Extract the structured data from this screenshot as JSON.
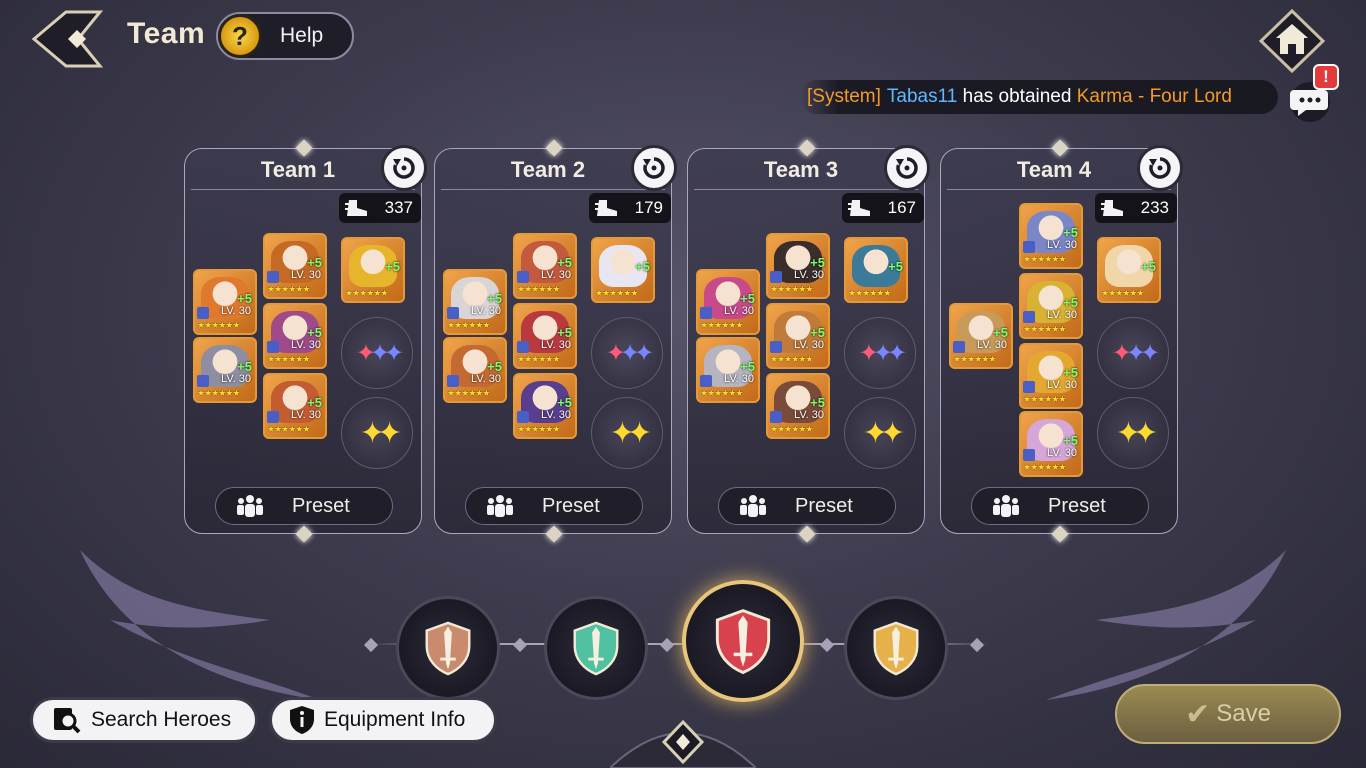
{
  "header": {
    "title": "Team",
    "help_label": "Help"
  },
  "system_message": {
    "prefix": "[System]",
    "player": "Tabas11",
    "middle": " has obtained ",
    "item": "Karma - Four Lord",
    "colors": {
      "prefix": "#f39a2c",
      "player": "#5fb7ff",
      "item": "#f39a2c",
      "text": "#ffffff"
    }
  },
  "chat": {
    "alert": "!"
  },
  "teams": [
    {
      "name": "Team 1",
      "power": "337",
      "preset_label": "Preset",
      "heroes": [
        {
          "lv": "LV. 30",
          "plus": "+5",
          "color": "#e0782e"
        },
        {
          "lv": "LV. 30",
          "plus": "+5",
          "color": "#c46a24"
        },
        {
          "lv": "LV. 30",
          "plus": "+5",
          "color": "#a04a8a"
        },
        {
          "lv": "LV. 30",
          "plus": "+5",
          "color": "#8d8ea2"
        },
        {
          "lv": "LV. 30",
          "plus": "+5",
          "color": "#c45c32"
        },
        {
          "lv": "",
          "plus": "+5",
          "color": "#e6b52c"
        }
      ]
    },
    {
      "name": "Team 2",
      "power": "179",
      "preset_label": "Preset",
      "heroes": [
        {
          "lv": "LV. 30",
          "plus": "+5",
          "color": "#d9d4d6"
        },
        {
          "lv": "LV. 30",
          "plus": "+5",
          "color": "#c35a3e"
        },
        {
          "lv": "LV. 30",
          "plus": "+5",
          "color": "#b83a3e"
        },
        {
          "lv": "LV. 30",
          "plus": "+5",
          "color": "#c36a32"
        },
        {
          "lv": "LV. 30",
          "plus": "+5",
          "color": "#5a3e8e"
        },
        {
          "lv": "",
          "plus": "+5",
          "color": "#e8e6f0"
        }
      ]
    },
    {
      "name": "Team 3",
      "power": "167",
      "preset_label": "Preset",
      "heroes": [
        {
          "lv": "LV. 30",
          "plus": "+5",
          "color": "#c84a8a"
        },
        {
          "lv": "LV. 30",
          "plus": "+5",
          "color": "#3a2e2c"
        },
        {
          "lv": "LV. 30",
          "plus": "+5",
          "color": "#c07a3a"
        },
        {
          "lv": "LV. 30",
          "plus": "+5",
          "color": "#b6b4c0"
        },
        {
          "lv": "LV. 30",
          "plus": "+5",
          "color": "#7a4a3a"
        },
        {
          "lv": "",
          "plus": "+5",
          "color": "#3c7a9a"
        }
      ]
    },
    {
      "name": "Team 4",
      "power": "233",
      "preset_label": "Preset",
      "heroes": [
        {
          "lv": "LV. 30",
          "plus": "+5",
          "color": "#c89a5a"
        },
        {
          "lv": "LV. 30",
          "plus": "+5",
          "color": "#7a86c8"
        },
        {
          "lv": "LV. 30",
          "plus": "+5",
          "color": "#d8b232"
        },
        {
          "lv": "LV. 30",
          "plus": "+5",
          "color": "#e4a830"
        },
        {
          "lv": "LV. 30",
          "plus": "+5",
          "color": "#d6a6d8"
        },
        {
          "lv": "",
          "plus": "+5",
          "color": "#f0d6a8"
        }
      ]
    }
  ],
  "stars": "★★★★★★",
  "emblems": [
    {
      "name": "bronze",
      "color": "#c98a6e"
    },
    {
      "name": "jade",
      "color": "#4fc0a0"
    },
    {
      "name": "crimson",
      "color": "#d8414e"
    },
    {
      "name": "gold",
      "color": "#e6b04a"
    }
  ],
  "buttons": {
    "search_heroes": "Search Heroes",
    "equipment_info": "Equipment Info",
    "save": "Save"
  }
}
